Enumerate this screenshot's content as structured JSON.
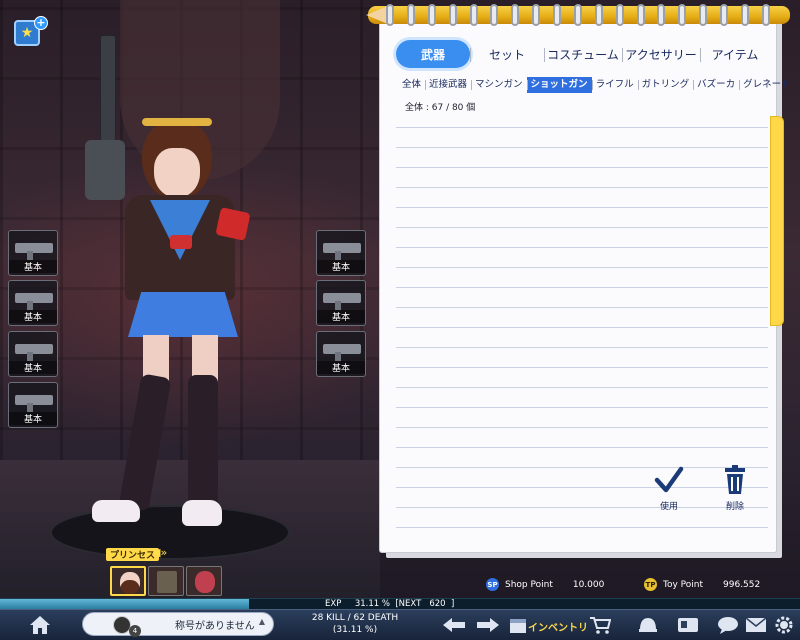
{
  "notebook": {
    "tabs": [
      {
        "label": "武器",
        "active": true
      },
      {
        "label": "セット",
        "active": false
      },
      {
        "label": "コスチューム",
        "active": false
      },
      {
        "label": "アクセサリー",
        "active": false
      },
      {
        "label": "アイテム",
        "active": false
      }
    ],
    "subtabs": [
      {
        "label": "全体",
        "active": false
      },
      {
        "label": "近接武器",
        "active": false
      },
      {
        "label": "マシンガン",
        "active": false
      },
      {
        "label": "ショットガン",
        "active": true
      },
      {
        "label": "ライフル",
        "active": false
      },
      {
        "label": "ガトリング",
        "active": false
      },
      {
        "label": "バズーカ",
        "active": false
      },
      {
        "label": "グレネード",
        "active": false
      }
    ],
    "count_text": "全体 : 67 / 80 個",
    "use_label": "使用",
    "delete_label": "削除"
  },
  "weapon_slots_left": [
    {
      "label": "基本"
    },
    {
      "label": "基本"
    },
    {
      "label": "基本"
    },
    {
      "label": "基本"
    }
  ],
  "weapon_slots_right": [
    {
      "label": "基本"
    },
    {
      "label": "基本"
    },
    {
      "label": "基本"
    }
  ],
  "points": {
    "shop_icon": "SP",
    "shop_label": "Shop Point",
    "shop_value": "10.000",
    "toy_icon": "TP",
    "toy_label": "Toy Point",
    "toy_value": "996.552"
  },
  "character": {
    "name_tag": "プリンセス",
    "selected_slot": 0,
    "slots": 3
  },
  "status": {
    "exp_text": "EXP     31.11 %  [NEXT   620  ]",
    "exp_fraction": 0.3111,
    "title_text": "称号がありません",
    "rank_number": "4",
    "kd_line1": "28 KILL / 62 DEATH",
    "kd_line2": "(31.11 %)",
    "inventory_label": "インベントリ"
  },
  "colors": {
    "accent": "#3a8ef0",
    "subtab_active": "#2f6fe0",
    "bookmark": "#ffd84a",
    "exp_fill": "#4aa3c6"
  },
  "icons": [
    "star-icon",
    "plus-icon",
    "check-icon",
    "trash-icon",
    "home-icon",
    "back-arrow-icon",
    "forward-arrow-icon",
    "calendar-icon",
    "cart-icon",
    "helmet-icon",
    "id-card-icon",
    "chat-icon",
    "mail-icon",
    "gear-icon",
    "sound-icon"
  ]
}
